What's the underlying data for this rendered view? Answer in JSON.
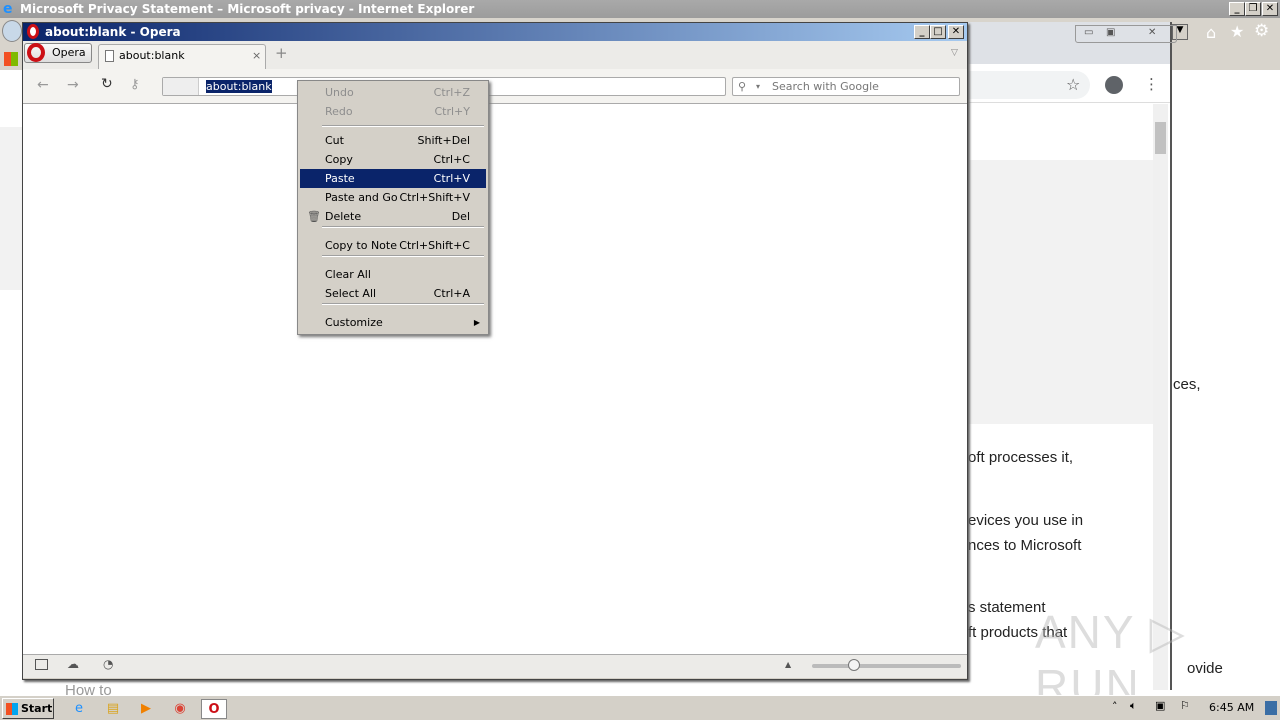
{
  "ie": {
    "title": "Microsoft Privacy Statement – Microsoft privacy - Internet Explorer",
    "content_fragments": [
      "ces,",
      "ovide",
      "How to"
    ]
  },
  "chrome": {
    "text_fragments": [
      "oft processes it,",
      "evices you use in",
      "nces to Microsoft",
      "s statement",
      "ft products that"
    ]
  },
  "opera": {
    "title": "about:blank - Opera",
    "menu_button": "Opera",
    "tab_label": "about:blank",
    "address_value": "about:blank",
    "search_placeholder": "Search with Google"
  },
  "context_menu": {
    "items": [
      {
        "label": "Undo",
        "shortcut": "Ctrl+Z",
        "disabled": true
      },
      {
        "label": "Redo",
        "shortcut": "Ctrl+Y",
        "disabled": true
      },
      {
        "label": "Cut",
        "shortcut": "Shift+Del"
      },
      {
        "label": "Copy",
        "shortcut": "Ctrl+C"
      },
      {
        "label": "Paste",
        "shortcut": "Ctrl+V",
        "highlighted": true
      },
      {
        "label": "Paste and Go",
        "shortcut": "Ctrl+Shift+V"
      },
      {
        "label": "Delete",
        "shortcut": "Del",
        "icon": "trash-icon"
      },
      {
        "label": "Copy to Note",
        "shortcut": "Ctrl+Shift+C"
      },
      {
        "label": "Clear All",
        "shortcut": ""
      },
      {
        "label": "Select All",
        "shortcut": "Ctrl+A"
      },
      {
        "label": "Customize",
        "shortcut": "",
        "submenu": true
      }
    ]
  },
  "taskbar": {
    "start": "Start",
    "clock": "6:45 AM"
  },
  "watermark": "ANY RUN",
  "colors": {
    "highlight": "#0a246a",
    "opera_red": "#cc0f16"
  }
}
